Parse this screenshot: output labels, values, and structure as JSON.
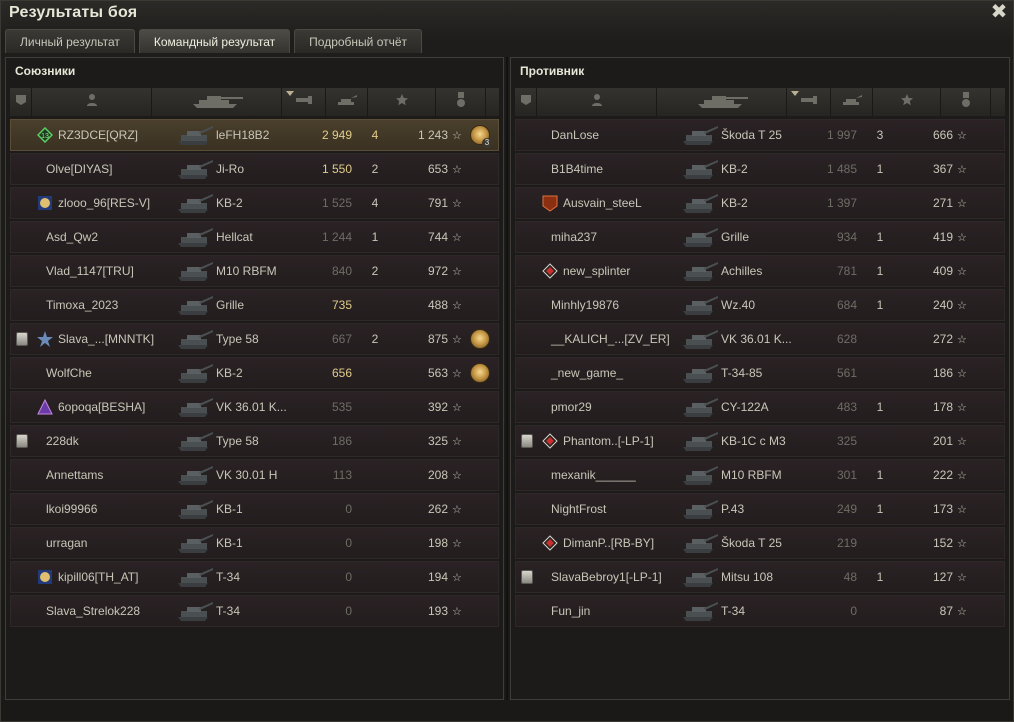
{
  "window": {
    "title": "Результаты боя",
    "close_symbol": "✖"
  },
  "tabs": [
    {
      "label": "Личный результат"
    },
    {
      "label": "Командный результат"
    },
    {
      "label": "Подробный отчёт"
    }
  ],
  "active_tab_index": 1,
  "ally": {
    "title": "Союзники",
    "rows": [
      {
        "squad": false,
        "clan_icon": "green-diamond-icon",
        "name": "RZ3DCE[QRZ]",
        "tank": "leFH18B2",
        "damage": "2 949",
        "damage_style": "gold",
        "frags": "4",
        "frags_style": "gold",
        "xp": "1 243",
        "medal": "medal-icon",
        "medal_count": "3",
        "highlight": true
      },
      {
        "squad": false,
        "clan_icon": "",
        "name": "Olve[DIYAS]",
        "tank": "Ji-Ro",
        "damage": "1 550",
        "damage_style": "gold",
        "frags": "2",
        "frags_style": "",
        "xp": "653",
        "medal": "",
        "medal_count": "",
        "highlight": false
      },
      {
        "squad": false,
        "clan_icon": "blue-clan-icon",
        "name": "zlooo_96[RES-V]",
        "tank": "KB-2",
        "damage": "1 525",
        "damage_style": "dim",
        "frags": "4",
        "frags_style": "",
        "xp": "791",
        "medal": "",
        "medal_count": "",
        "highlight": false
      },
      {
        "squad": false,
        "clan_icon": "",
        "name": "Asd_Qw2",
        "tank": "Hellcat",
        "damage": "1 244",
        "damage_style": "dim",
        "frags": "1",
        "frags_style": "",
        "xp": "744",
        "medal": "",
        "medal_count": "",
        "highlight": false
      },
      {
        "squad": false,
        "clan_icon": "",
        "name": "Vlad_1147[TRU]",
        "tank": "M10 RBFM",
        "damage": "840",
        "damage_style": "dim",
        "frags": "2",
        "frags_style": "",
        "xp": "972",
        "medal": "",
        "medal_count": "",
        "highlight": false
      },
      {
        "squad": false,
        "clan_icon": "",
        "name": "Timoxa_2023",
        "tank": "Grille",
        "damage": "735",
        "damage_style": "gold",
        "frags": "",
        "frags_style": "",
        "xp": "488",
        "medal": "",
        "medal_count": "",
        "highlight": false
      },
      {
        "squad": true,
        "clan_icon": "star-clan-icon",
        "name": "Slava_...[MNNTK]",
        "tank": "Type 58",
        "damage": "667",
        "damage_style": "dim",
        "frags": "2",
        "frags_style": "",
        "xp": "875",
        "medal": "medal-icon",
        "medal_count": "",
        "highlight": false
      },
      {
        "squad": false,
        "clan_icon": "",
        "name": "WolfChe",
        "tank": "KB-2",
        "damage": "656",
        "damage_style": "gold",
        "frags": "",
        "frags_style": "",
        "xp": "563",
        "medal": "medal-icon",
        "medal_count": "",
        "highlight": false
      },
      {
        "squad": false,
        "clan_icon": "purple-clan-icon",
        "name": "6opoqa[BESHA]",
        "tank": "VK 36.01 K...",
        "damage": "535",
        "damage_style": "dim",
        "frags": "",
        "frags_style": "",
        "xp": "392",
        "medal": "",
        "medal_count": "",
        "highlight": false
      },
      {
        "squad": true,
        "clan_icon": "",
        "name": "228dk",
        "tank": "Type 58",
        "damage": "186",
        "damage_style": "dim",
        "frags": "",
        "frags_style": "",
        "xp": "325",
        "medal": "",
        "medal_count": "",
        "highlight": false
      },
      {
        "squad": false,
        "clan_icon": "",
        "name": "Annettams",
        "tank": "VK 30.01 H",
        "damage": "113",
        "damage_style": "dim",
        "frags": "",
        "frags_style": "",
        "xp": "208",
        "medal": "",
        "medal_count": "",
        "highlight": false
      },
      {
        "squad": false,
        "clan_icon": "",
        "name": "lkoi99966",
        "tank": "KB-1",
        "damage": "0",
        "damage_style": "dim",
        "frags": "",
        "frags_style": "",
        "xp": "262",
        "medal": "",
        "medal_count": "",
        "highlight": false
      },
      {
        "squad": false,
        "clan_icon": "",
        "name": "urragan",
        "tank": "KB-1",
        "damage": "0",
        "damage_style": "dim",
        "frags": "",
        "frags_style": "",
        "xp": "198",
        "medal": "",
        "medal_count": "",
        "highlight": false
      },
      {
        "squad": false,
        "clan_icon": "blue-clan-icon",
        "name": "kipill06[TH_AT]",
        "tank": "T-34",
        "damage": "0",
        "damage_style": "dim",
        "frags": "",
        "frags_style": "",
        "xp": "194",
        "medal": "",
        "medal_count": "",
        "highlight": false
      },
      {
        "squad": false,
        "clan_icon": "",
        "name": "Slava_Strelok228",
        "tank": "T-34",
        "damage": "0",
        "damage_style": "dim",
        "frags": "",
        "frags_style": "",
        "xp": "193",
        "medal": "",
        "medal_count": "",
        "highlight": false
      }
    ]
  },
  "enemy": {
    "title": "Противник",
    "rows": [
      {
        "squad": false,
        "clan_icon": "",
        "name": "DanLose",
        "tank": "Škoda T 25",
        "damage": "1 997",
        "damage_style": "dim",
        "frags": "3",
        "frags_style": "",
        "xp": "666",
        "medal": "",
        "medal_count": ""
      },
      {
        "squad": false,
        "clan_icon": "",
        "name": "B1B4time",
        "tank": "KB-2",
        "damage": "1 485",
        "damage_style": "dim",
        "frags": "1",
        "frags_style": "",
        "xp": "367",
        "medal": "",
        "medal_count": ""
      },
      {
        "squad": false,
        "clan_icon": "orange-clan-icon",
        "name": "Ausvain_steeL",
        "tank": "KB-2",
        "damage": "1 397",
        "damage_style": "dim",
        "frags": "",
        "frags_style": "",
        "xp": "271",
        "medal": "",
        "medal_count": ""
      },
      {
        "squad": false,
        "clan_icon": "",
        "name": "miha237",
        "tank": "Grille",
        "damage": "934",
        "damage_style": "dim",
        "frags": "1",
        "frags_style": "",
        "xp": "419",
        "medal": "",
        "medal_count": ""
      },
      {
        "squad": false,
        "clan_icon": "red-diamond-icon",
        "name": "new_splinter",
        "tank": "Achilles",
        "damage": "781",
        "damage_style": "dim",
        "frags": "1",
        "frags_style": "",
        "xp": "409",
        "medal": "",
        "medal_count": ""
      },
      {
        "squad": false,
        "clan_icon": "",
        "name": "Minhly19876",
        "tank": "Wz.40",
        "damage": "684",
        "damage_style": "dim",
        "frags": "1",
        "frags_style": "",
        "xp": "240",
        "medal": "",
        "medal_count": ""
      },
      {
        "squad": false,
        "clan_icon": "",
        "name": "__KALICH_...[ZV_ER]",
        "tank": "VK 36.01 K...",
        "damage": "628",
        "damage_style": "dim",
        "frags": "",
        "frags_style": "",
        "xp": "272",
        "medal": "",
        "medal_count": ""
      },
      {
        "squad": false,
        "clan_icon": "",
        "name": "_new_game_",
        "tank": "T-34-85",
        "damage": "561",
        "damage_style": "dim",
        "frags": "",
        "frags_style": "",
        "xp": "186",
        "medal": "",
        "medal_count": ""
      },
      {
        "squad": false,
        "clan_icon": "",
        "name": "pmor29",
        "tank": "CY-122A",
        "damage": "483",
        "damage_style": "dim",
        "frags": "1",
        "frags_style": "",
        "xp": "178",
        "medal": "",
        "medal_count": ""
      },
      {
        "squad": true,
        "clan_icon": "red-diamond-icon",
        "name": "Phantom..[-LP-1]",
        "tank": "KB-1C c M3",
        "damage": "325",
        "damage_style": "dim",
        "frags": "",
        "frags_style": "",
        "xp": "201",
        "medal": "",
        "medal_count": ""
      },
      {
        "squad": false,
        "clan_icon": "",
        "name": "mexanik______",
        "tank": "M10 RBFM",
        "damage": "301",
        "damage_style": "dim",
        "frags": "1",
        "frags_style": "",
        "xp": "222",
        "medal": "",
        "medal_count": ""
      },
      {
        "squad": false,
        "clan_icon": "",
        "name": "NightFrost",
        "tank": "P.43",
        "damage": "249",
        "damage_style": "dim",
        "frags": "1",
        "frags_style": "",
        "xp": "173",
        "medal": "",
        "medal_count": ""
      },
      {
        "squad": false,
        "clan_icon": "red-diamond-icon",
        "name": "DimanP..[RB-BY]",
        "tank": "Škoda T 25",
        "damage": "219",
        "damage_style": "dim",
        "frags": "",
        "frags_style": "",
        "xp": "152",
        "medal": "",
        "medal_count": ""
      },
      {
        "squad": true,
        "clan_icon": "",
        "name": "SlavaBebroy1[-LP-1]",
        "tank": "Mitsu 108",
        "damage": "48",
        "damage_style": "dim",
        "frags": "1",
        "frags_style": "",
        "xp": "127",
        "medal": "",
        "medal_count": ""
      },
      {
        "squad": false,
        "clan_icon": "",
        "name": "Fun_jin",
        "tank": "T-34",
        "damage": "0",
        "damage_style": "dim",
        "frags": "",
        "frags_style": "",
        "xp": "87",
        "medal": "",
        "medal_count": ""
      }
    ]
  },
  "columns": [
    {
      "id": "squad",
      "icon": "squad-icon"
    },
    {
      "id": "player",
      "icon": "player-icon"
    },
    {
      "id": "tank",
      "icon": "tank-icon"
    },
    {
      "id": "damage",
      "icon": "damage-icon",
      "sorted": true
    },
    {
      "id": "frags",
      "icon": "frags-icon"
    },
    {
      "id": "xp",
      "icon": "star-icon"
    },
    {
      "id": "medal",
      "icon": "medal-column-icon"
    }
  ],
  "star_glyph": "☆",
  "colors": {
    "gold": "#e0cc8a",
    "dim": "#6e6d66",
    "text": "#c8c6b8",
    "highlight": "#4a3f2c"
  }
}
